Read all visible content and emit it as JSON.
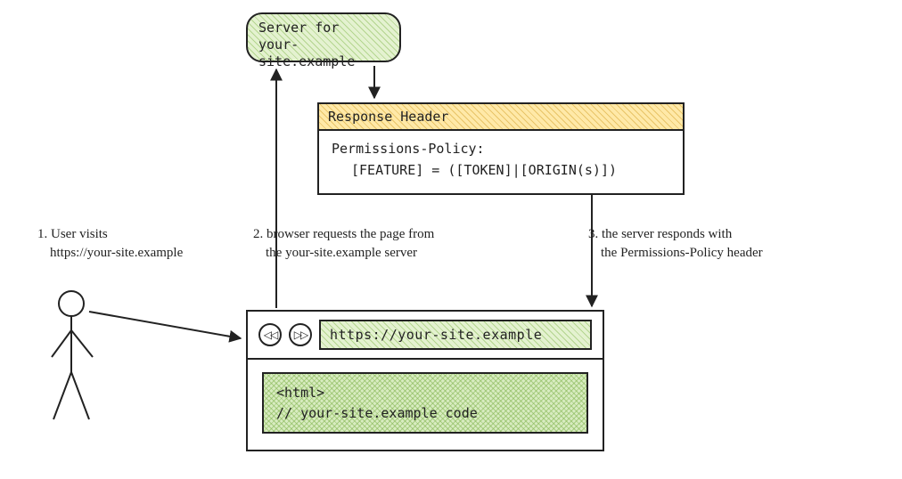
{
  "server": {
    "line1": "Server for",
    "line2": "your-site.example"
  },
  "response_header": {
    "title": "Response Header",
    "policy_key": "Permissions-Policy:",
    "policy_value": "[FEATURE] = ([TOKEN]|[ORIGIN(s)])"
  },
  "steps": {
    "s1a": "1. User visits",
    "s1b": "https://your-site.example",
    "s2a": "2. browser requests the page from",
    "s2b": "the your-site.example server",
    "s3a": "3. the server responds with",
    "s3b": "the Permissions-Policy header"
  },
  "browser": {
    "back_glyph": "◁◁",
    "fwd_glyph": "▷▷",
    "url": "https://your-site.example",
    "code_line1": "<html>",
    "code_line2": "// your-site.example code"
  }
}
